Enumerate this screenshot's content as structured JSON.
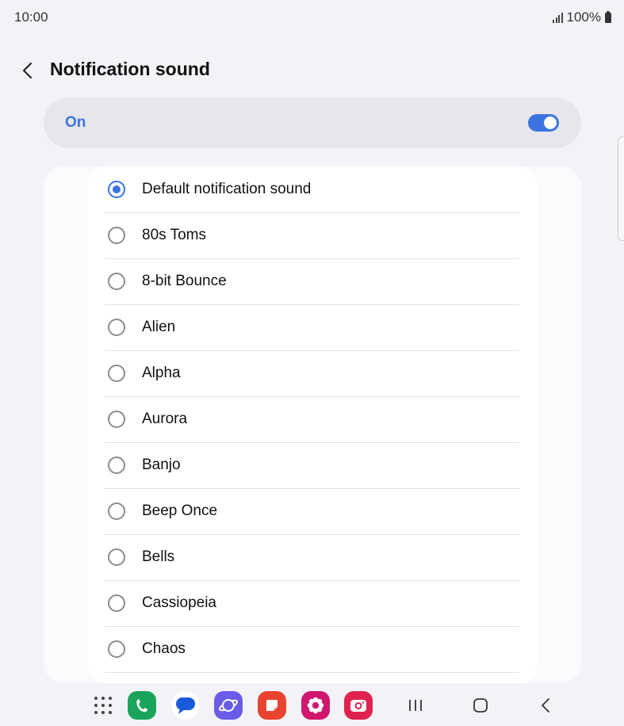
{
  "status_bar": {
    "time": "10:00",
    "battery": "100%"
  },
  "header": {
    "title": "Notification sound",
    "back_icon": "chevron-left-icon"
  },
  "master_switch": {
    "label": "On",
    "enabled": true,
    "accent_color": "#3b74e0"
  },
  "sounds": [
    {
      "label": "Default notification sound",
      "selected": true
    },
    {
      "label": "80s Toms",
      "selected": false
    },
    {
      "label": "8-bit Bounce",
      "selected": false
    },
    {
      "label": "Alien",
      "selected": false
    },
    {
      "label": "Alpha",
      "selected": false
    },
    {
      "label": "Aurora",
      "selected": false
    },
    {
      "label": "Banjo",
      "selected": false
    },
    {
      "label": "Beep Once",
      "selected": false
    },
    {
      "label": "Bells",
      "selected": false
    },
    {
      "label": "Cassiopeia",
      "selected": false
    },
    {
      "label": "Chaos",
      "selected": false
    }
  ],
  "nav_bar": {
    "apps": [
      {
        "name": "apps-grid-icon"
      },
      {
        "name": "phone-app-icon",
        "color": "#1aa45b"
      },
      {
        "name": "messages-app-icon",
        "color": "#ffffff"
      },
      {
        "name": "internet-app-icon",
        "color": "#6a5ce8"
      },
      {
        "name": "notes-app-icon",
        "color": "#e8442f"
      },
      {
        "name": "gallery-app-icon",
        "color": "#d0176f"
      },
      {
        "name": "camera-app-icon",
        "color": "#e0224f"
      }
    ],
    "buttons": [
      "recents-icon",
      "home-icon",
      "back-icon"
    ]
  }
}
